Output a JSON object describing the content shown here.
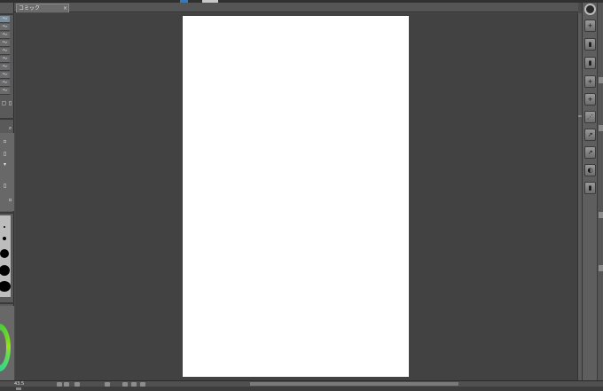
{
  "canvas_tab": {
    "title": "コミック",
    "close_symbol": "×"
  },
  "status": {
    "zoom": "43.5"
  },
  "left_tools": [
    "〜",
    "〜",
    "〜",
    "〜",
    "〜",
    "〜",
    "〜",
    "〜",
    "〜",
    "〜"
  ],
  "right_tools": [
    "+",
    "▮",
    "▮",
    "+",
    "+",
    "⋰",
    "↗",
    "↗",
    "◐",
    "▮"
  ],
  "colors": {
    "workspace_bg": "#424242",
    "page_bg": "#ffffff",
    "panel_bg": "#5a5a5a",
    "color_wheel_green": "#22c24b"
  }
}
